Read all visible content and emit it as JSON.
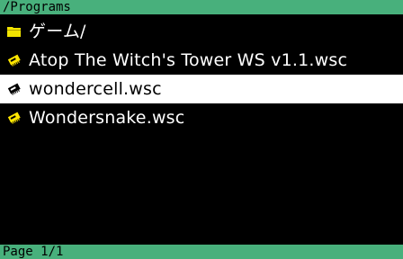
{
  "header": {
    "path": "/Programs"
  },
  "files": [
    {
      "name": "ゲーム/",
      "icon": "folder-icon",
      "selected": false
    },
    {
      "name": "Atop The Witch's Tower WS v1.1.wsc",
      "icon": "cartridge-icon",
      "selected": false
    },
    {
      "name": "wondercell.wsc",
      "icon": "cartridge-icon",
      "selected": true
    },
    {
      "name": "Wondersnake.wsc",
      "icon": "cartridge-icon",
      "selected": false
    }
  ],
  "footer": {
    "page": "Page 1/1"
  },
  "colors": {
    "bar": "#48b07c",
    "background": "#000000",
    "selection": "#ffffff",
    "folder": "#f2e400",
    "cartridge": "#ffe600"
  }
}
